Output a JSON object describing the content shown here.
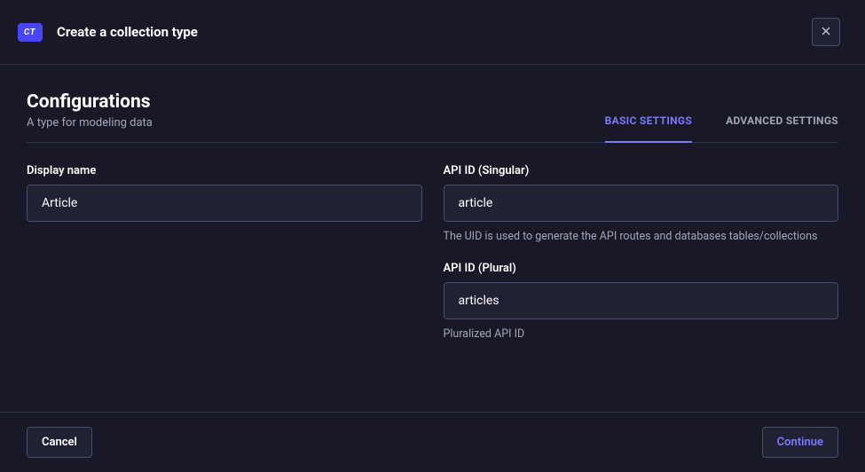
{
  "header": {
    "badge": "CT",
    "title": "Create a collection type"
  },
  "config": {
    "title": "Configurations",
    "subtitle": "A type for modeling data"
  },
  "tabs": {
    "basic": "BASIC SETTINGS",
    "advanced": "ADVANCED SETTINGS"
  },
  "form": {
    "displayName": {
      "label": "Display name",
      "value": "Article"
    },
    "apiSingular": {
      "label": "API ID (Singular)",
      "value": "article",
      "helper": "The UID is used to generate the API routes and databases tables/collections"
    },
    "apiPlural": {
      "label": "API ID (Plural)",
      "value": "articles",
      "helper": "Pluralized API ID"
    }
  },
  "footer": {
    "cancel": "Cancel",
    "continue": "Continue"
  }
}
